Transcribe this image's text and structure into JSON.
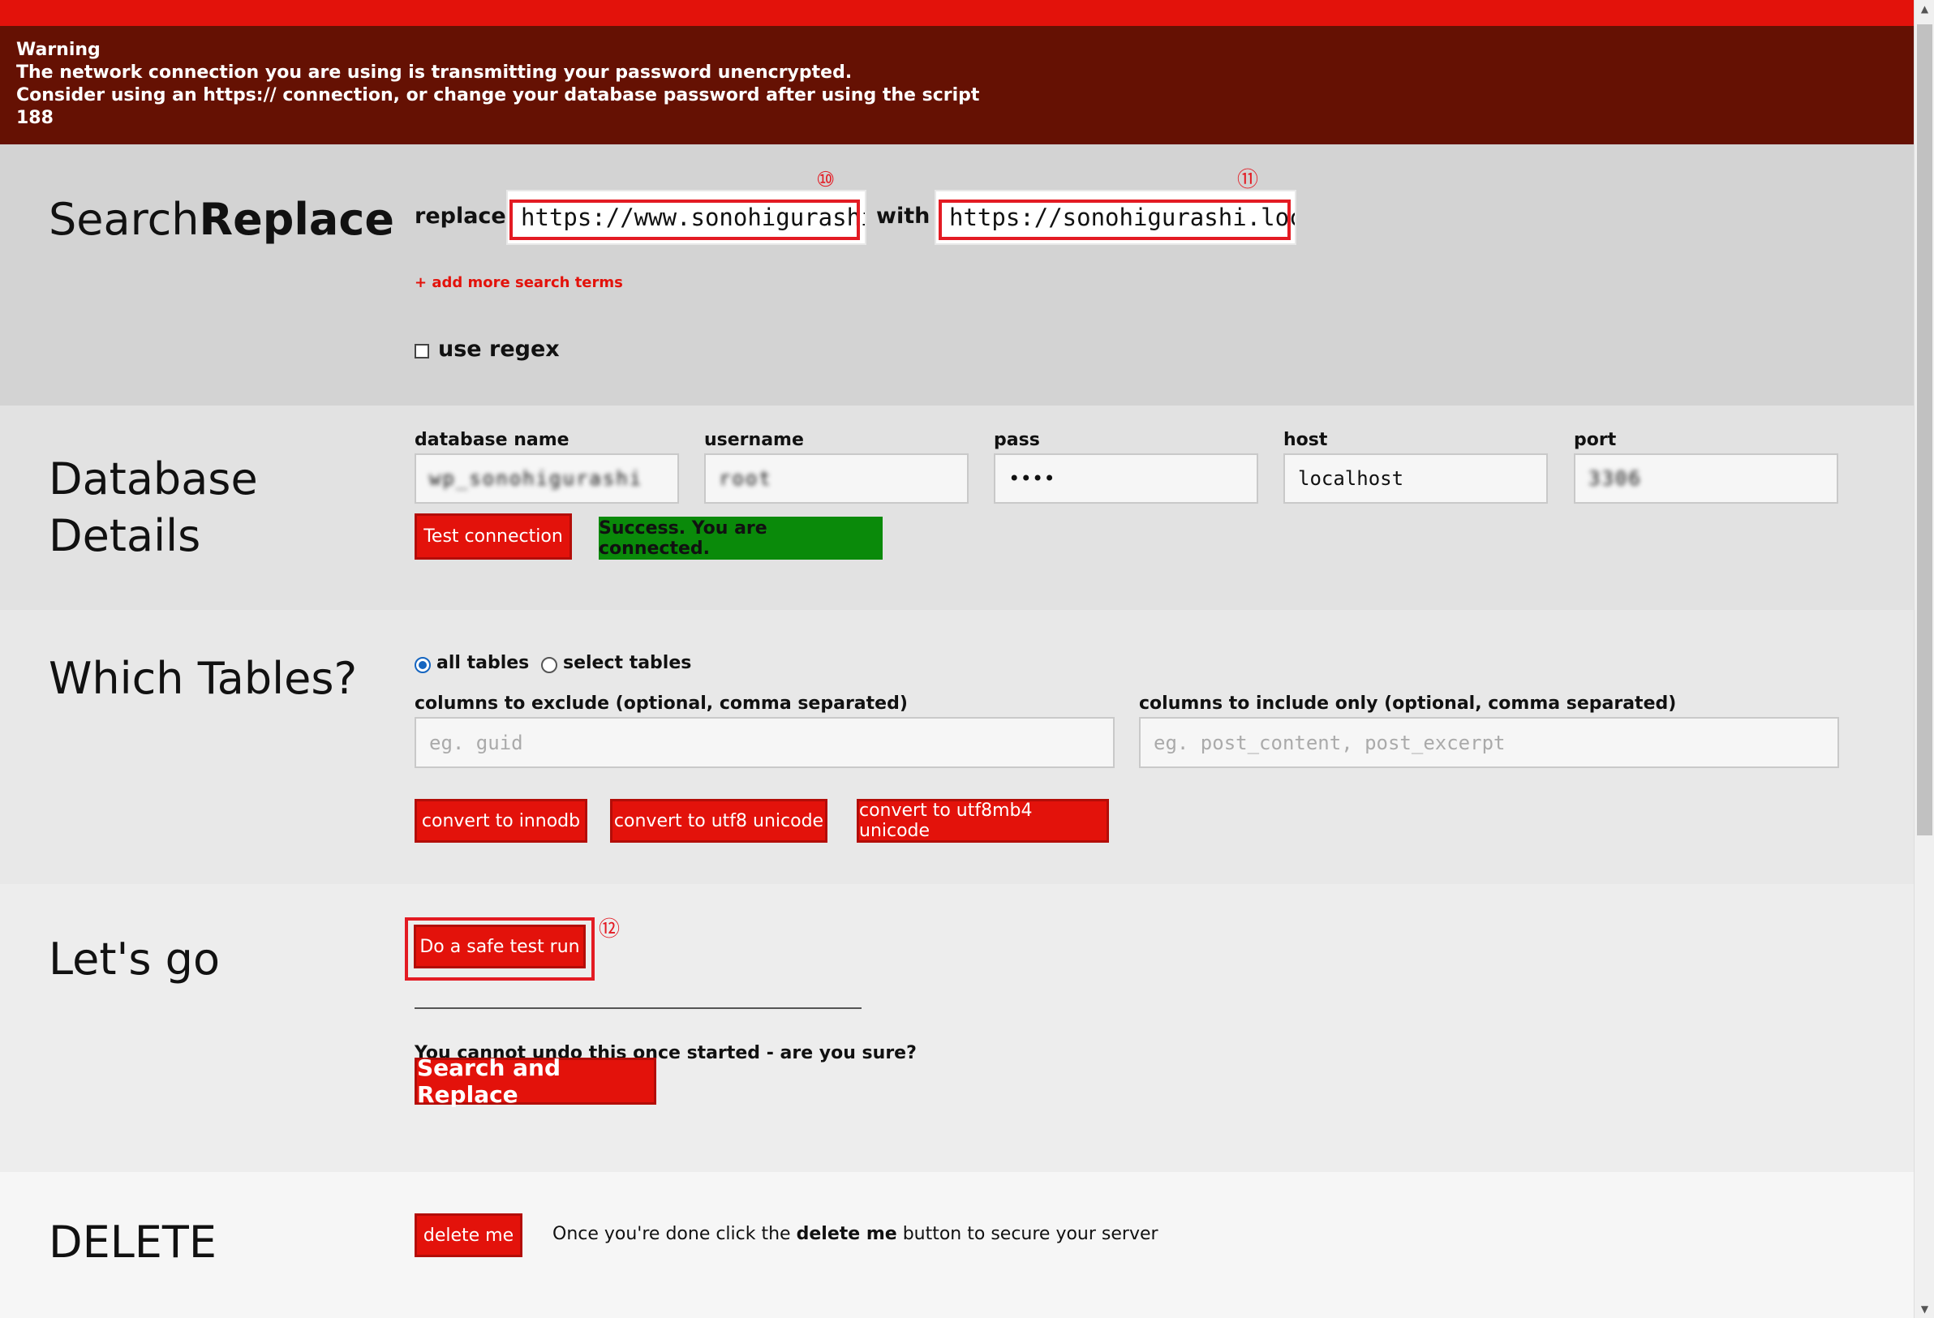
{
  "warning": {
    "title": "Warning",
    "line1": "The network connection you are using is transmitting your password unencrypted.",
    "line2": "Consider using an https:// connection, or change your database password after using the script",
    "code": "188"
  },
  "search": {
    "heading_light": "Search",
    "heading_bold": "Replace",
    "replace_label": "replace",
    "replace_value": "https://www.sonohigurashi",
    "with_label": "with",
    "with_value": "https://sonohigurashi.loc",
    "add_terms_link": "+ add more search terms",
    "regex_label": "use regex"
  },
  "database": {
    "heading_line1": "Database",
    "heading_line2": "Details",
    "name_label": "database name",
    "name_value": "wp_sonohigurashi",
    "username_label": "username",
    "username_value": "root",
    "pass_label": "pass",
    "pass_value": "••••",
    "host_label": "host",
    "host_value": "localhost",
    "port_label": "port",
    "port_value": "3306",
    "test_button": "Test connection",
    "success_message": "Success. You are connected."
  },
  "tables": {
    "heading": "Which Tables?",
    "all_tables": "all tables",
    "select_tables": "select tables",
    "exclude_label": "columns to exclude (optional, comma separated)",
    "exclude_placeholder": "eg. guid",
    "include_label": "columns to include only (optional, comma separated)",
    "include_placeholder": "eg. post_content, post_excerpt",
    "btn_innodb": "convert to innodb",
    "btn_utf8": "convert to utf8 unicode",
    "btn_utf8mb4": "convert to utf8mb4 unicode"
  },
  "go": {
    "heading": "Let's go",
    "dry_run_button": "Do a safe test run",
    "confirm_text": "You cannot undo this once started - are you sure?",
    "run_button": "Search and Replace"
  },
  "delete": {
    "heading": "DELETE",
    "button": "delete me",
    "text_before": "Once you're done click the",
    "text_bold": "delete me",
    "text_after": "button to secure your server"
  },
  "annotations": {
    "n10": "⑩",
    "n11": "⑪",
    "n12": "⑫"
  },
  "colors": {
    "accent_red": "#e3120b",
    "warning_bg": "#651103",
    "success_green": "#0a8a0a",
    "callout_red": "#e31b23"
  }
}
